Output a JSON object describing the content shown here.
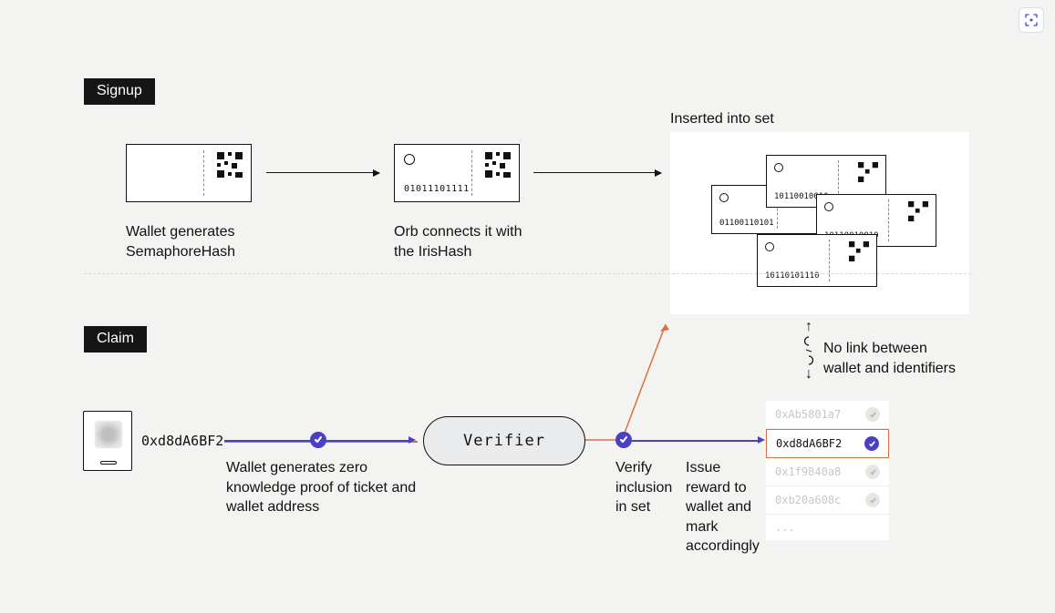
{
  "signup": {
    "tag": "Signup",
    "step1": "Wallet generates SemaphoreHash",
    "step2_line1": "Orb connects it with",
    "step2_line2": "the IrisHash",
    "step2_hash": "01011101111",
    "set_title": "Inserted into set",
    "set_hashes": [
      "01100110101",
      "10110010010",
      "10110010010",
      "10110101110"
    ]
  },
  "claim": {
    "tag": "Claim",
    "wallet_addr": "0xd8dA6BF2",
    "proof_text": "Wallet generates zero knowledge proof of ticket and wallet address",
    "verifier_label": "Verifier",
    "verify_text_l1": "Verify",
    "verify_text_l2": "inclusion",
    "verify_text_l3": "in set",
    "issue_text_l1": "Issue",
    "issue_text_l2": "reward to",
    "issue_text_l3": "wallet and",
    "issue_text_l4": "mark",
    "issue_text_l5": "accordingly",
    "wallets": [
      "0xAb5801a7",
      "0xd8dA6BF2",
      "0x1f9840a8",
      "0xb20a608c",
      "..."
    ],
    "active_wallet_index": 1,
    "no_link_l1": "No link between",
    "no_link_l2": "wallet and identifiers"
  },
  "icons": {
    "scan": "scan-icon",
    "qr": "qr-icon"
  }
}
